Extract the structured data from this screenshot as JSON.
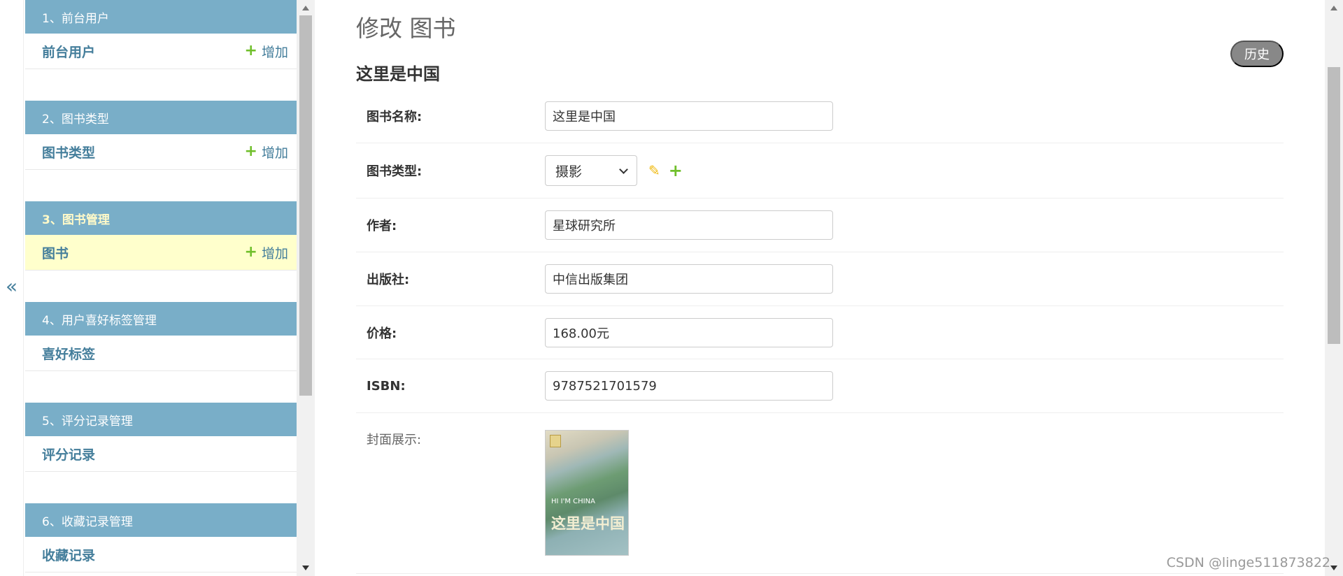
{
  "collapse_toggle": "«",
  "sidebar": {
    "modules": [
      {
        "header": "1、前台用户",
        "item": "前台用户",
        "add_label": "增加",
        "has_add": true
      },
      {
        "header": "2、图书类型",
        "item": "图书类型",
        "add_label": "增加",
        "has_add": true
      },
      {
        "header": "3、图书管理",
        "item": "图书",
        "add_label": "增加",
        "has_add": true,
        "active": true
      },
      {
        "header": "4、用户喜好标签管理",
        "item": "喜好标签"
      },
      {
        "header": "5、评分记录管理",
        "item": "评分记录"
      },
      {
        "header": "6、收藏记录管理",
        "item": "收藏记录"
      }
    ]
  },
  "main": {
    "page_title": "修改 图书",
    "history_button": "历史",
    "object_title": "这里是中国",
    "fields": {
      "name": {
        "label": "图书名称:",
        "value": "这里是中国"
      },
      "category": {
        "label": "图书类型:",
        "value": "摄影"
      },
      "author": {
        "label": "作者:",
        "value": "星球研究所"
      },
      "publisher": {
        "label": "出版社:",
        "value": "中信出版集团"
      },
      "price": {
        "label": "价格:",
        "value": "168.00元"
      },
      "isbn": {
        "label": "ISBN:",
        "value": "9787521701579"
      },
      "cover": {
        "label": "封面展示:",
        "en_text": "HI I'M CHINA",
        "zh_text": "这里是中国"
      }
    }
  },
  "watermark": "CSDN @linge511873822",
  "colors": {
    "module_header": "#79aec8",
    "active_header_text": "#fffac9",
    "active_row": "#ffffcc",
    "link": "#447e9b",
    "add_icon": "#70bf2b",
    "edit_icon": "#efb80b",
    "history_button": "#888888"
  },
  "icons": {
    "add": "plus-icon",
    "edit": "pencil-icon",
    "select": "chevron-down-icon"
  }
}
